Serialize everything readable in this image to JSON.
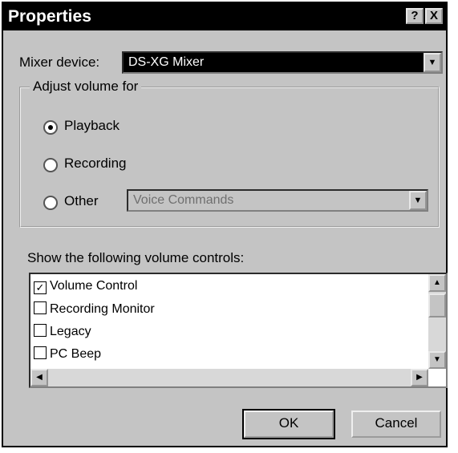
{
  "window": {
    "title": "Properties",
    "help_label": "?",
    "close_label": "X"
  },
  "mixer": {
    "label": "Mixer device:",
    "value": "DS-XG Mixer"
  },
  "adjust": {
    "legend": "Adjust volume for",
    "options": [
      {
        "label": "Playback",
        "selected": true
      },
      {
        "label": "Recording",
        "selected": false
      },
      {
        "label": "Other",
        "selected": false
      }
    ],
    "other_value": "Voice Commands"
  },
  "controls": {
    "label": "Show the following volume controls:",
    "items": [
      {
        "label": "Volume Control",
        "checked": true,
        "mark": "✓"
      },
      {
        "label": "Recording Monitor",
        "checked": false,
        "mark": ""
      },
      {
        "label": "Legacy",
        "checked": false,
        "mark": ""
      },
      {
        "label": "PC Beep",
        "checked": false,
        "mark": ""
      }
    ]
  },
  "buttons": {
    "ok": "OK",
    "cancel": "Cancel"
  },
  "icons": {
    "scroll_up": "▲",
    "scroll_down": "▼",
    "scroll_left": "◀",
    "scroll_right": "▶",
    "dropdown": "▼"
  }
}
